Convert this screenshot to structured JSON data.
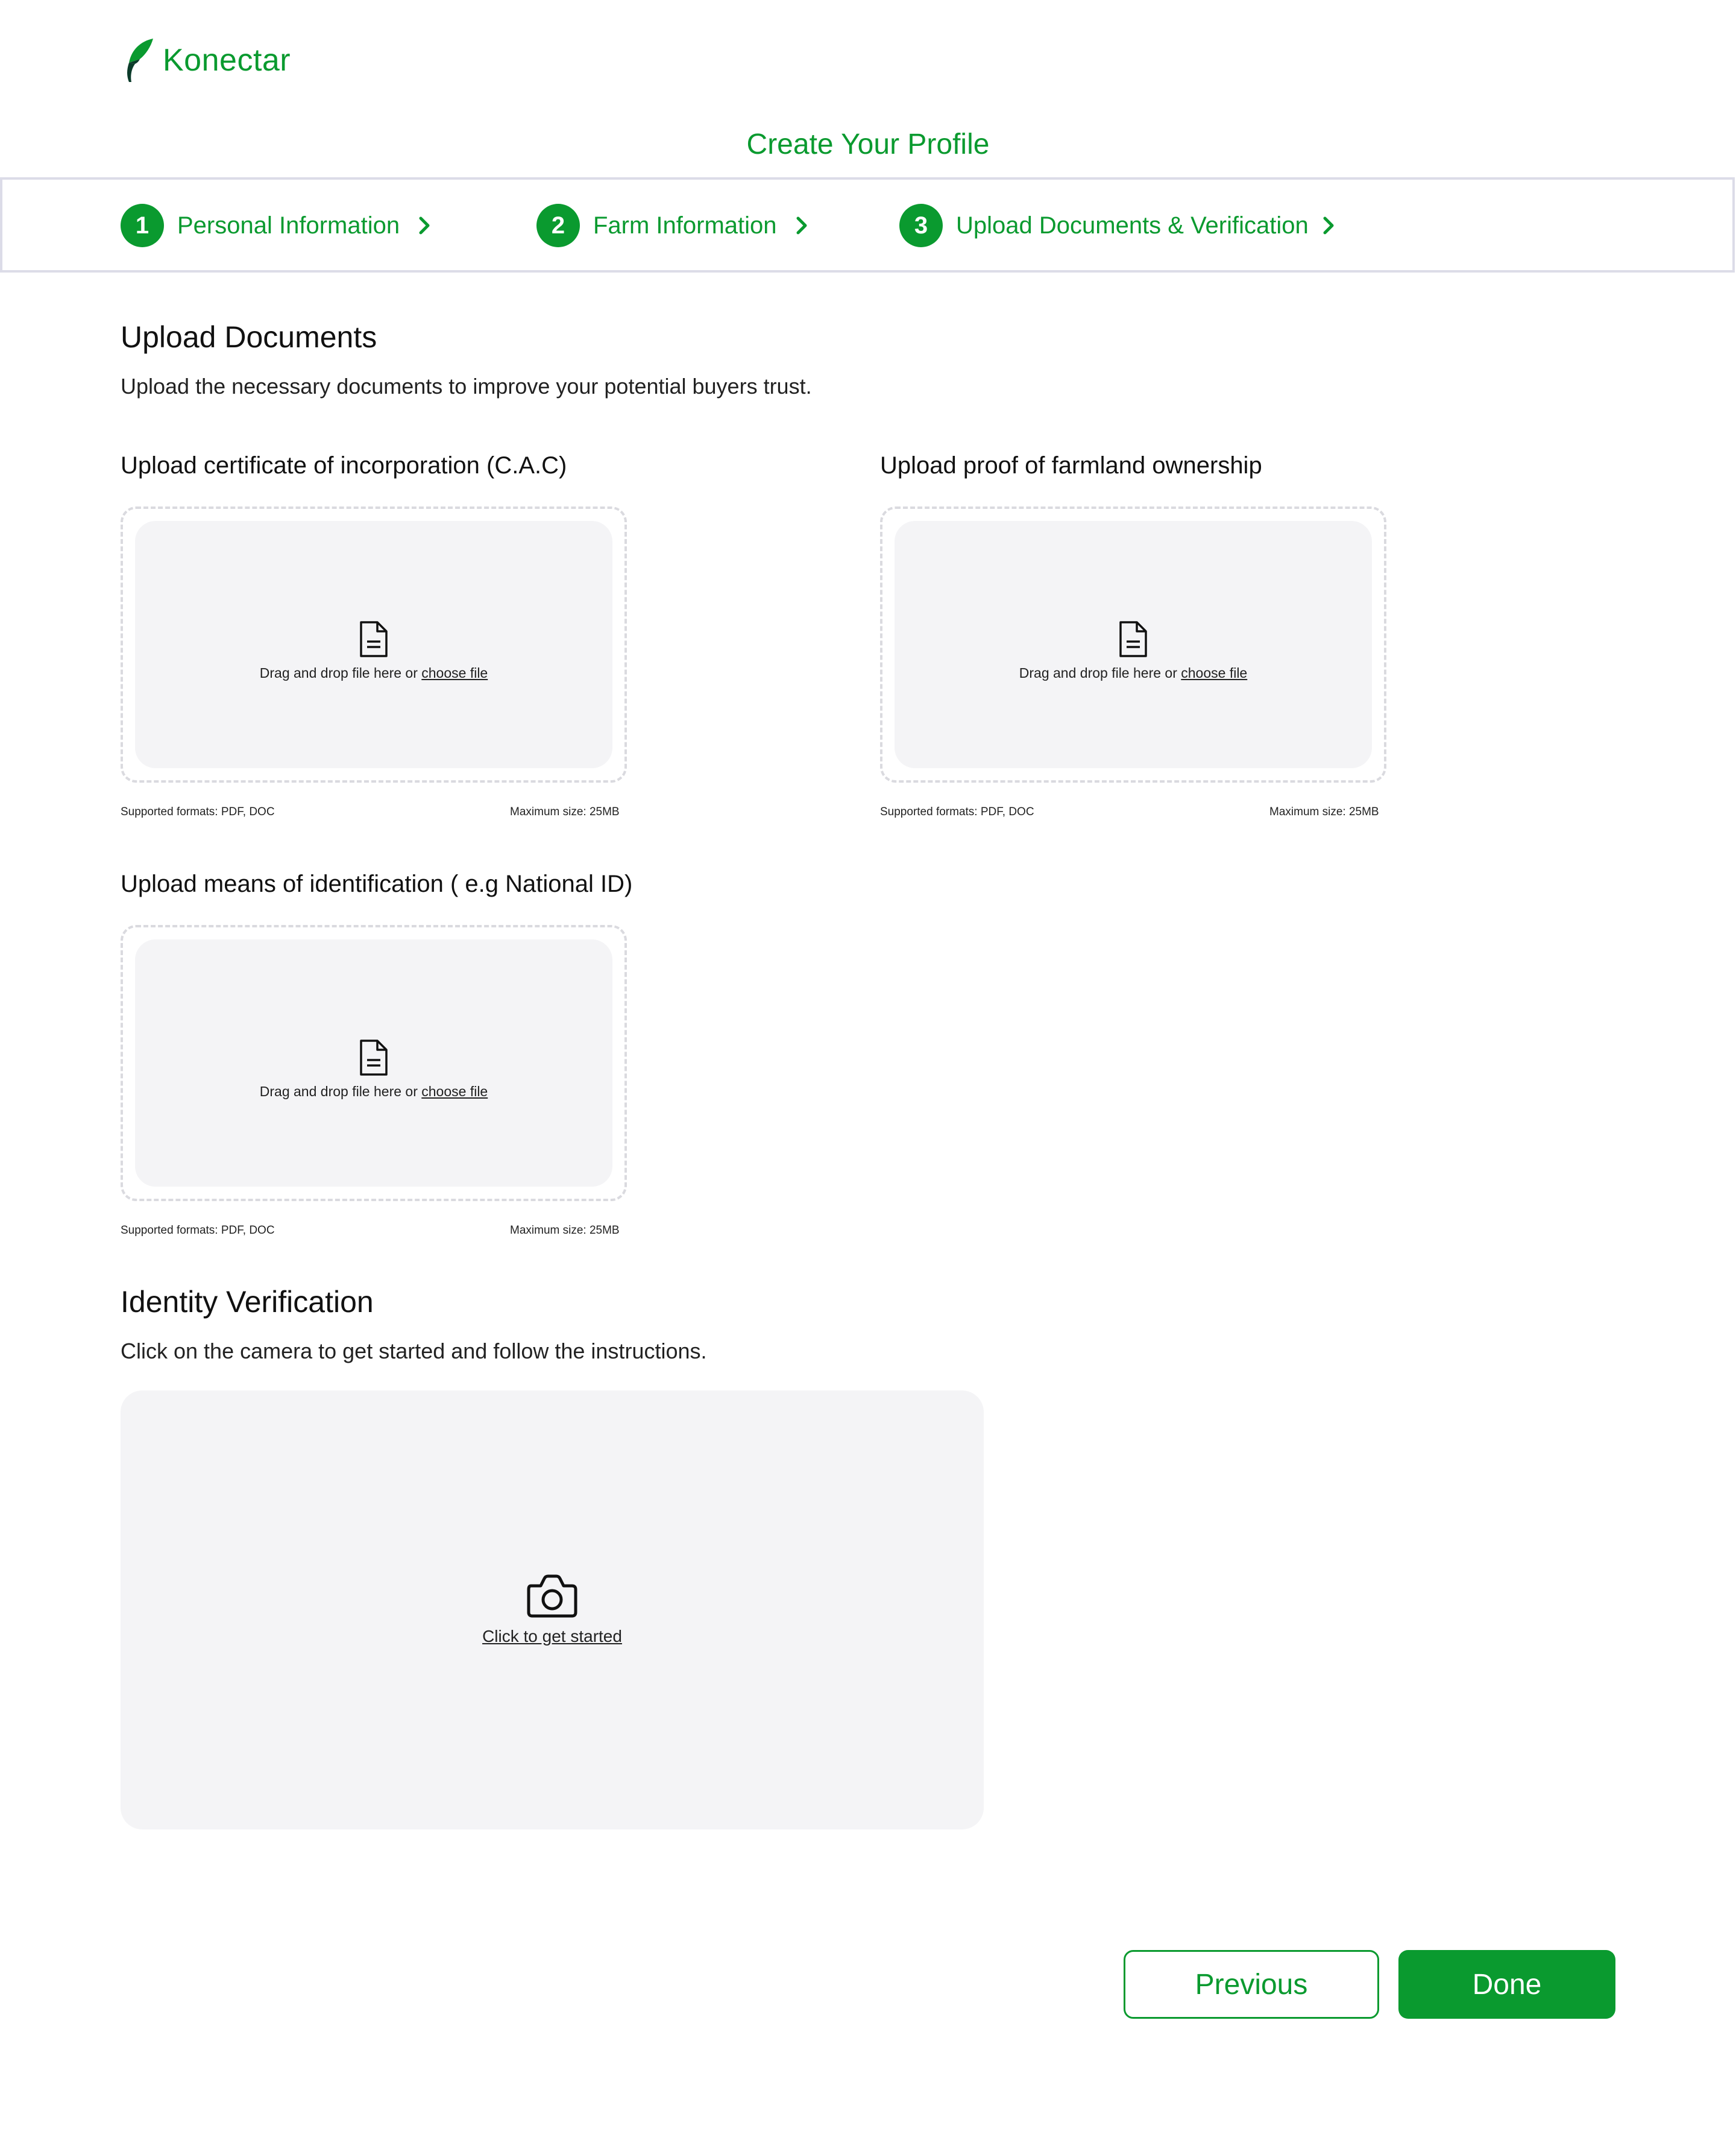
{
  "brand": {
    "name": "Konectar",
    "logo_icon": "leaf-logo-icon",
    "color": "#0a9a2f"
  },
  "page": {
    "title": "Create Your Profile"
  },
  "stepper": {
    "steps": [
      {
        "number": "1",
        "label": "Personal Information"
      },
      {
        "number": "2",
        "label": "Farm Information"
      },
      {
        "number": "3",
        "label": "Upload Documents & Verification"
      }
    ]
  },
  "upload_documents": {
    "title": "Upload Documents",
    "description": "Upload the necessary documents to improve your potential buyers trust.",
    "fields": [
      {
        "label": "Upload certificate of incorporation (C.A.C)",
        "drop_text": "Drag and drop file here or ",
        "choose_text": "choose file",
        "formats": "Supported formats: PDF, DOC",
        "max_size": "Maximum size: 25MB"
      },
      {
        "label": "Upload proof of farmland ownership",
        "drop_text": "Drag and drop file here or ",
        "choose_text": "choose file",
        "formats": "Supported formats: PDF, DOC",
        "max_size": "Maximum size: 25MB"
      },
      {
        "label": "Upload means of identification ( e.g National ID)",
        "drop_text": "Drag and drop file here or ",
        "choose_text": "choose file",
        "formats": "Supported formats: PDF, DOC",
        "max_size": "Maximum size: 25MB"
      }
    ]
  },
  "identity_verification": {
    "title": "Identity Verification",
    "description": "Click on the camera to get started and follow the instructions.",
    "camera_text": "Click to get started",
    "icon": "camera-icon"
  },
  "actions": {
    "previous": "Previous",
    "done": "Done"
  }
}
